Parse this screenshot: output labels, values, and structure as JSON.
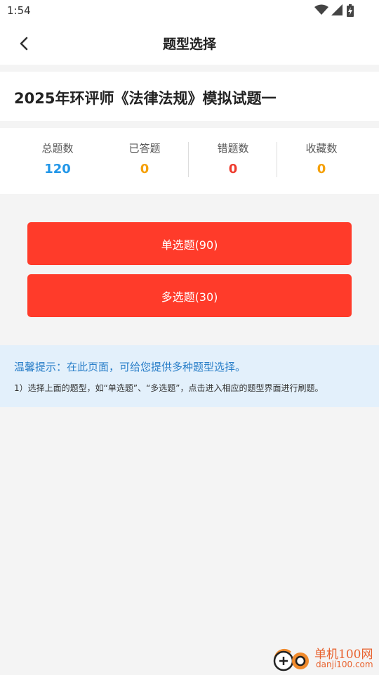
{
  "status_bar": {
    "time": "1:54",
    "icons": [
      "wifi-icon",
      "signal-icon",
      "battery-charging-icon"
    ]
  },
  "nav": {
    "title": "题型选择",
    "back_icon": "chevron-left-icon"
  },
  "exam": {
    "title": "2025年环评师《法律法规》模拟试题一"
  },
  "stats": [
    {
      "label": "总题数",
      "value": "120",
      "color": "#2196e8"
    },
    {
      "label": "已答题",
      "value": "0",
      "color": "#f5a10c"
    },
    {
      "label": "错题数",
      "value": "0",
      "color": "#ee3a2c"
    },
    {
      "label": "收藏数",
      "value": "0",
      "color": "#f5a10c"
    }
  ],
  "buttons": {
    "single_choice": "单选题(90)",
    "multiple_choice": "多选题(30)"
  },
  "tip": {
    "title": "温馨提示：在此页面，可给您提供多种题型选择。",
    "text": "1）选择上面的题型，如“单选题”、“多选题”，点击进入相应的题型界面进行刷题。"
  },
  "watermark": {
    "name": "单机100网",
    "url": "danji100.com"
  },
  "colors": {
    "accent": "#ff3b2a",
    "tip_background": "#e3f0fb",
    "tip_title": "#2a7fc9",
    "page_background": "#f4f4f4"
  }
}
